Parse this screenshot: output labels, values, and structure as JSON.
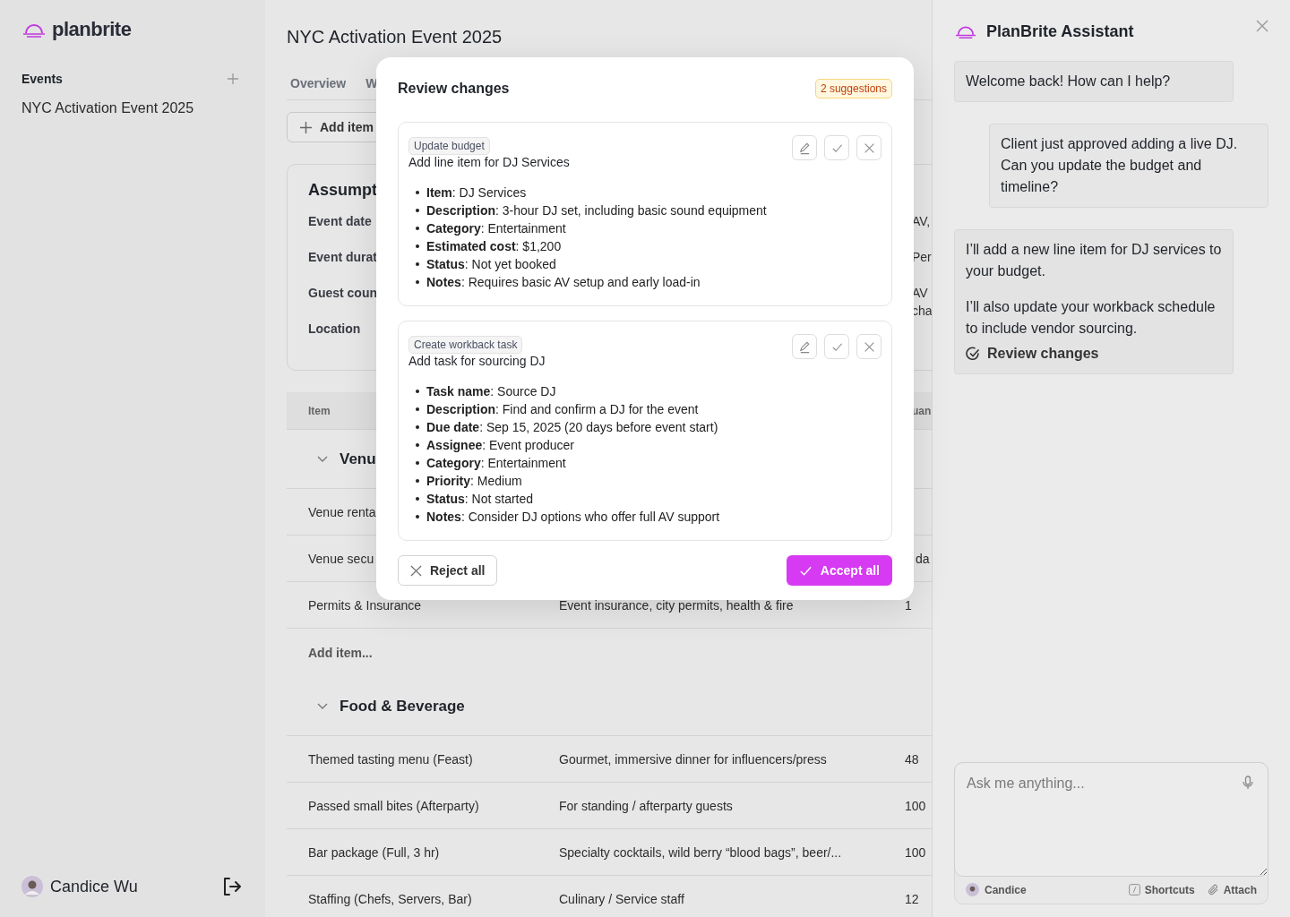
{
  "sidebar": {
    "logo": "planbrite",
    "section_title": "Events",
    "events": [
      {
        "label": "NYC Activation Event 2025",
        "selected": false
      }
    ],
    "user": {
      "name": "Candice Wu"
    }
  },
  "main": {
    "title": "NYC Activation Event 2025",
    "tabs": [
      {
        "label": "Overview",
        "selected": false
      },
      {
        "label": "W",
        "selected": false
      }
    ],
    "add_button": "Add item",
    "assumptions": {
      "title": "Assumpt",
      "rows": [
        {
          "label": "Event date",
          "values": [
            "AV,"
          ]
        },
        {
          "label": "Event durat",
          "values": [
            "Per"
          ]
        },
        {
          "label": "Guest coun",
          "values": [
            "AV",
            "cha"
          ]
        },
        {
          "label": "Location",
          "values": []
        }
      ]
    },
    "table": {
      "columns": [
        "Item",
        "uan"
      ],
      "groups": [
        {
          "name": "Venu",
          "expanded": true,
          "add_label": "Add item...",
          "rows": [
            {
              "item": "Venue renta"
            },
            {
              "item": "Venue secu",
              "description_tail": "da"
            },
            {
              "item": "Permits & Insurance",
              "description": "Event insurance, city permits, health & fire",
              "quantity": "1"
            }
          ]
        },
        {
          "name": "Food & Beverage",
          "expanded": true,
          "rows": [
            {
              "item": "Themed tasting menu (Feast)",
              "description": "Gourmet, immersive dinner for influencers/press",
              "quantity": "48"
            },
            {
              "item": "Passed small bites (Afterparty)",
              "description": "For standing / afterparty guests",
              "quantity": "100"
            },
            {
              "item": "Bar package (Full, 3 hr)",
              "description": "Specialty cocktails, wild berry “blood bags”, beer/...",
              "quantity": "100"
            },
            {
              "item": "Staffing (Chefs, Servers, Bar)",
              "description": "Culinary / Service staff",
              "quantity": "12"
            }
          ]
        }
      ]
    }
  },
  "modal": {
    "title": "Review changes",
    "badge": "2 suggestions",
    "suggestions": [
      {
        "tag": "Update budget",
        "title": "Add line item for DJ Services",
        "fields": [
          "**Item**: DJ Services",
          "**Description**: 3-hour DJ set, including basic sound equipment",
          "**Category**: Entertainment",
          "**Estimated cost**: $1,200",
          "**Status**: Not yet booked",
          "**Notes**: Requires basic AV setup and early load-in"
        ]
      },
      {
        "tag": "Create workback task",
        "title": "Add task for sourcing DJ",
        "fields": [
          "**Task name**: Source DJ",
          "**Description**: Find and confirm a DJ for the event",
          "**Due date**: Sep 15, 2025 (20 days before event start)",
          "**Assignee**: Event producer",
          "**Category**: Entertainment",
          "**Priority**: Medium",
          "**Status**: Not started",
          "**Notes**: Consider DJ options who offer full AV support"
        ]
      }
    ],
    "reject": "Reject all",
    "accept": "Accept all"
  },
  "assistant": {
    "title": "PlanBrite Assistant",
    "messages": [
      {
        "kind": "assistant",
        "paragraphs": [
          "Welcome back! How can I help?"
        ]
      },
      {
        "kind": "user",
        "paragraphs": [
          "Client just approved adding a live DJ. Can you update the budget and timeline?"
        ]
      },
      {
        "kind": "assistant",
        "paragraphs": [
          "I’ll add a new line item for DJ services to your budget.",
          "I’ll also update your workback schedule to include vendor sourcing."
        ],
        "link": "Review changes"
      }
    ],
    "input": {
      "placeholder": "Ask me anything...",
      "user": "Candice",
      "shortcuts": "Shortcuts",
      "attach": "Attach"
    }
  }
}
